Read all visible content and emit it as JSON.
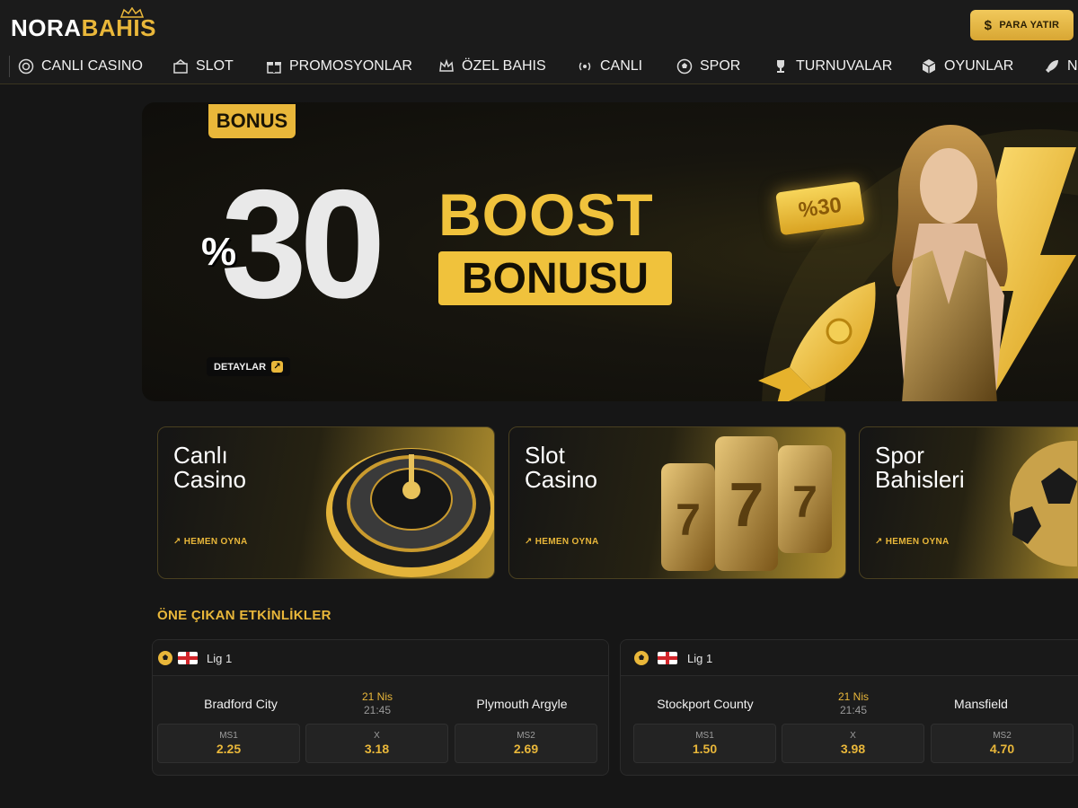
{
  "header": {
    "logo_white": "NORA",
    "logo_yellow": "BAHIS",
    "deposit_label": "PARA YATIR"
  },
  "nav": {
    "items": [
      {
        "label": "CANLI CASINO",
        "icon": "chip-icon"
      },
      {
        "label": "SLOT",
        "icon": "slot-icon"
      },
      {
        "label": "PROMOSYONLAR",
        "icon": "gift-icon"
      },
      {
        "label": "ÖZEL BAHIS",
        "icon": "crown-icon"
      },
      {
        "label": "CANLI",
        "icon": "live-icon"
      },
      {
        "label": "SPOR",
        "icon": "soccer-ball-icon"
      },
      {
        "label": "TURNUVALAR",
        "icon": "trophy-icon"
      },
      {
        "label": "OYUNLAR",
        "icon": "cube-icon"
      },
      {
        "label": "NO",
        "icon": "rocket-icon"
      }
    ]
  },
  "banner": {
    "tag": "BONUS",
    "percent_sign": "%",
    "number": "30",
    "line1": "BOOST",
    "line2": "BONUSU",
    "ticket": "%30",
    "details_label": "DETAYLAR"
  },
  "cards": [
    {
      "title_line1": "Canlı",
      "title_line2": "Casino",
      "cta": "HEMEN OYNA"
    },
    {
      "title_line1": "Slot",
      "title_line2": "Casino",
      "cta": "HEMEN OYNA"
    },
    {
      "title_line1": "Spor",
      "title_line2": "Bahisleri",
      "cta": "HEMEN OYNA"
    }
  ],
  "featured": {
    "title": "ÖNE ÇIKAN ETKİNLİKLER",
    "events": [
      {
        "league": "Lig 1",
        "home": "Bradford City",
        "away": "Plymouth Argyle",
        "date": "21 Nis",
        "time": "21:45",
        "odds": [
          {
            "label": "MS1",
            "value": "2.25"
          },
          {
            "label": "X",
            "value": "3.18"
          },
          {
            "label": "MS2",
            "value": "2.69"
          }
        ]
      },
      {
        "league": "Lig 1",
        "home": "Stockport County",
        "away": "Mansfield",
        "date": "21 Nis",
        "time": "21:45",
        "odds": [
          {
            "label": "MS1",
            "value": "1.50"
          },
          {
            "label": "X",
            "value": "3.98"
          },
          {
            "label": "MS2",
            "value": "4.70"
          }
        ]
      }
    ]
  },
  "colors": {
    "accent": "#e9b73a",
    "background": "#161616"
  }
}
